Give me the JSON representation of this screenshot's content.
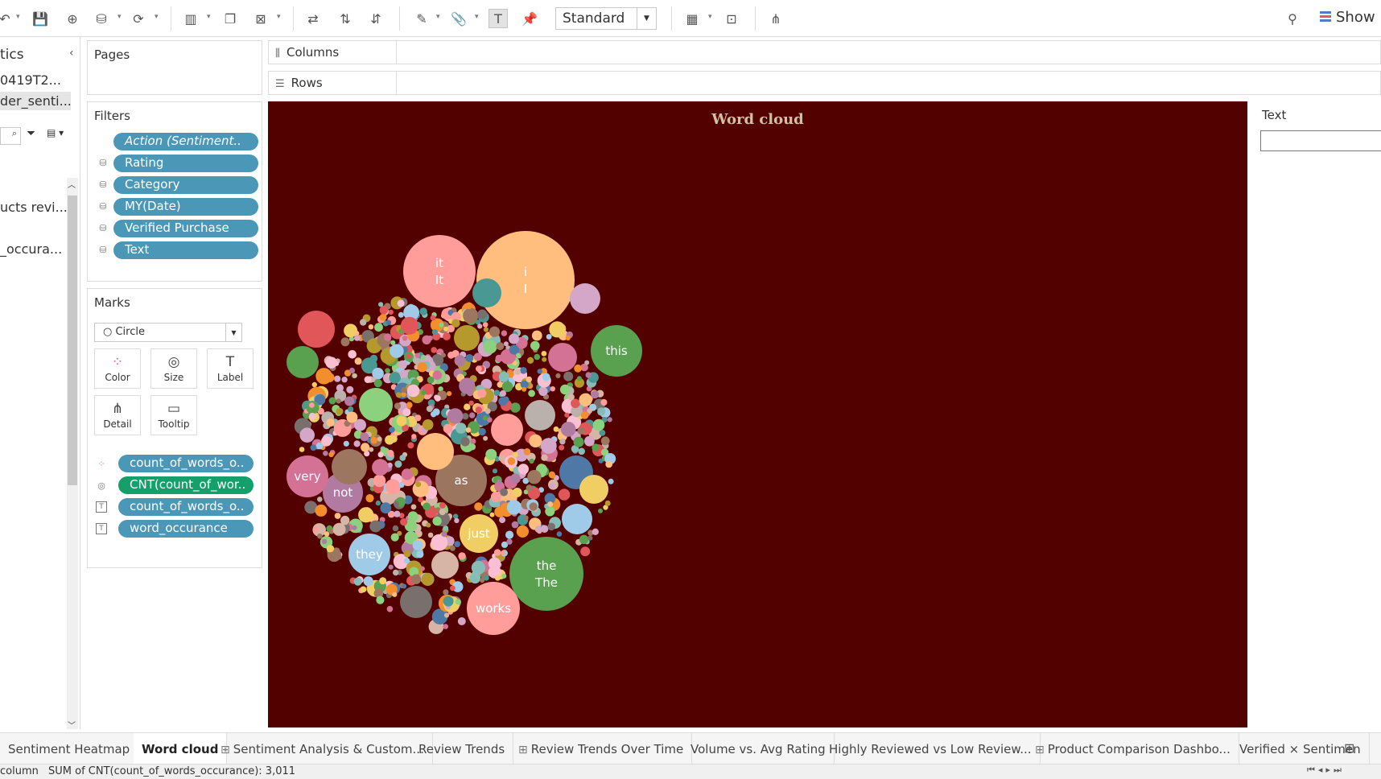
{
  "toolbar": {
    "view_dropdown": "Standard",
    "show_me": "Show M"
  },
  "data_pane": {
    "title": "tics",
    "datasource": "0419T2...",
    "selected_source": "der_senti...",
    "field_1": "ucts revi...",
    "field_2": "_occura..."
  },
  "pages_card": {
    "title": "Pages"
  },
  "filters_card": {
    "title": "Filters",
    "filters": [
      {
        "label": "Action (Sentiment..",
        "italic": true
      },
      {
        "label": "Rating"
      },
      {
        "label": "Category"
      },
      {
        "label": "MY(Date)"
      },
      {
        "label": "Verified Purchase"
      },
      {
        "label": "Text"
      }
    ]
  },
  "marks_card": {
    "title": "Marks",
    "mark_type": "Circle",
    "buttons": [
      "Color",
      "Size",
      "Label",
      "Detail",
      "Tooltip"
    ],
    "fields": [
      {
        "label": "count_of_words_o..",
        "icon": "color-icon"
      },
      {
        "label": "CNT(count_of_wor..",
        "icon": "size-icon",
        "green": true
      },
      {
        "label": "count_of_words_o..",
        "icon": "label-icon"
      },
      {
        "label": "word_occurance",
        "icon": "label-icon"
      }
    ]
  },
  "shelves": {
    "columns": "Columns",
    "rows": "Rows"
  },
  "viz": {
    "title": "Word cloud",
    "labeled_bubbles": [
      {
        "line1": "i",
        "line2": "I",
        "color": "#ffbe7d"
      },
      {
        "line1": "it",
        "line2": "It",
        "color": "#ff9d9a"
      },
      {
        "line1": "this",
        "line2": "",
        "color": "#59a14f"
      },
      {
        "line1": "the",
        "line2": "The",
        "color": "#59a14f"
      },
      {
        "line1": "works",
        "line2": "",
        "color": "#ff9d9a"
      },
      {
        "line1": "just",
        "line2": "",
        "color": "#f1ce63"
      },
      {
        "line1": "as",
        "line2": "",
        "color": "#9c755f"
      },
      {
        "line1": "not",
        "line2": "",
        "color": "#b07aa1"
      },
      {
        "line1": "very",
        "line2": "",
        "color": "#d37295"
      },
      {
        "line1": "they",
        "line2": "",
        "color": "#a0cbe8"
      }
    ],
    "palette": [
      "#4e79a7",
      "#a0cbe8",
      "#f28e2b",
      "#ffbe7d",
      "#59a14f",
      "#8cd17d",
      "#b6992d",
      "#f1ce63",
      "#499894",
      "#86bcb6",
      "#e15759",
      "#ff9d9a",
      "#79706e",
      "#bab0ac",
      "#d37295",
      "#fabfd2",
      "#b07aa1",
      "#d4a6c8",
      "#9d7660",
      "#d7b5a6"
    ]
  },
  "text_filter": {
    "title": "Text",
    "value": ""
  },
  "tabs": [
    {
      "label": "Sentiment Heatmap",
      "icon": ""
    },
    {
      "label": "Word cloud",
      "icon": "",
      "active": true
    },
    {
      "label": "Sentiment Analysis & Custom...",
      "icon": "⊞"
    },
    {
      "label": "Review Trends",
      "icon": ""
    },
    {
      "label": "Review Trends Over Time",
      "icon": "⊞"
    },
    {
      "label": "Volume vs. Avg Rating",
      "icon": ""
    },
    {
      "label": "Highly Reviewed vs Low Review...",
      "icon": ""
    },
    {
      "label": "Product Comparison Dashbo...",
      "icon": "⊞"
    },
    {
      "label": "Verified × Sentimen",
      "icon": ""
    }
  ],
  "status": {
    "left": "column",
    "summary": "SUM of CNT(count_of_words_occurance): 3,011"
  }
}
